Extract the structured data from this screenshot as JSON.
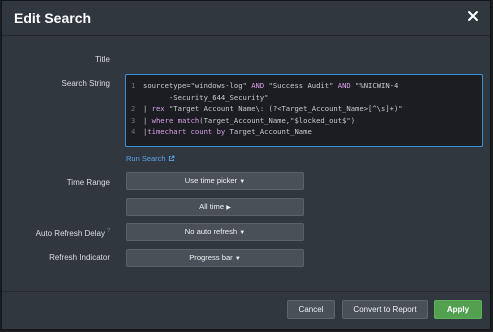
{
  "dialog": {
    "title": "Edit Search"
  },
  "labels": {
    "title": "Title",
    "search_string": "Search String",
    "time_range": "Time Range",
    "auto_refresh": "Auto Refresh Delay",
    "refresh_indicator": "Refresh Indicator"
  },
  "editor": {
    "lines": [
      {
        "num": "1",
        "parts": [
          {
            "t": "sourcetype=\"windows-log\" ",
            "c": ""
          },
          {
            "t": "AND",
            "c": "kw"
          },
          {
            "t": " \"Success Audit\" ",
            "c": ""
          },
          {
            "t": "AND",
            "c": "kw"
          },
          {
            "t": " \"%NICWIN-4",
            "c": ""
          }
        ]
      },
      {
        "num": "",
        "parts": [
          {
            "t": "      -Security_644_Security\"",
            "c": ""
          }
        ]
      },
      {
        "num": "2",
        "parts": [
          {
            "t": "| ",
            "c": ""
          },
          {
            "t": "rex",
            "c": "kw"
          },
          {
            "t": " \"Target Account Name\\: (?<Target_Account_Name>[^\\s]+)\"",
            "c": ""
          }
        ]
      },
      {
        "num": "3",
        "parts": [
          {
            "t": "| ",
            "c": ""
          },
          {
            "t": "where",
            "c": "kw"
          },
          {
            "t": " ",
            "c": ""
          },
          {
            "t": "match",
            "c": "fn"
          },
          {
            "t": "(Target_Account_Name,\"$locked_out$\")",
            "c": ""
          }
        ]
      },
      {
        "num": "4",
        "parts": [
          {
            "t": "|",
            "c": ""
          },
          {
            "t": "timechart",
            "c": "kw"
          },
          {
            "t": " ",
            "c": ""
          },
          {
            "t": "count",
            "c": "fn"
          },
          {
            "t": " ",
            "c": ""
          },
          {
            "t": "by",
            "c": "kw"
          },
          {
            "t": " Target_Account_Name",
            "c": ""
          }
        ]
      }
    ]
  },
  "run_search": {
    "label": "Run Search"
  },
  "controls": {
    "time_picker": "Use time picker",
    "all_time": "All time",
    "auto_refresh": "No auto refresh",
    "refresh_indicator": "Progress bar"
  },
  "footer": {
    "cancel": "Cancel",
    "convert": "Convert to Report",
    "apply": "Apply"
  },
  "colors": {
    "accent": "#3c8fd6",
    "apply": "#53a051",
    "link": "#5aa4f0"
  }
}
